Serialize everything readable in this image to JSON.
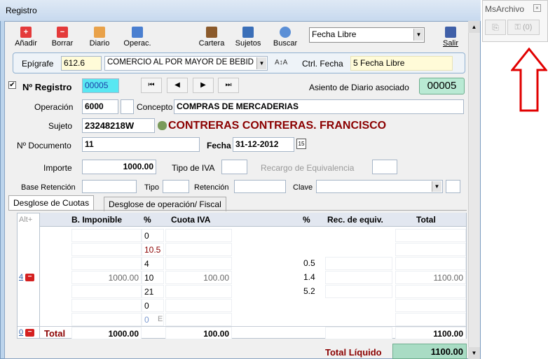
{
  "window": {
    "title": "Registro"
  },
  "toolbar": {
    "add": "Añadir",
    "delete": "Borrar",
    "journal": "Diario",
    "operations": "Operac.",
    "portfolio": "Cartera",
    "subjects": "Sujetos",
    "search": "Buscar",
    "exit": "Salir",
    "date_filter": "Fecha Libre"
  },
  "epigrafe": {
    "label": "Epígrafe",
    "code": "612.6",
    "description": "COMERCIO AL POR MAYOR DE BEBID",
    "ctrl_label": "Ctrl. Fecha",
    "ctrl_value": "5 Fecha Libre"
  },
  "registro": {
    "label": "Nº Registro",
    "value": "00005",
    "asiento_label": "Asiento de Diario asociado",
    "asiento_value": "00005"
  },
  "nav": {
    "first": "⏮",
    "prev": "◀",
    "next": "▶",
    "last": "⏭"
  },
  "form": {
    "operacion_label": "Operación",
    "operacion": "6000",
    "concepto_label": "Concepto",
    "concepto": "COMPRAS DE MERCADERIAS",
    "sujeto_label": "Sujeto",
    "sujeto_id": "23248218W",
    "sujeto_name": "CONTRERAS CONTRERAS. FRANCISCO",
    "documento_label": "Nº Documento",
    "documento": "11",
    "fecha_label": "Fecha",
    "fecha": "31-12-2012",
    "calendar": "15",
    "importe_label": "Importe",
    "importe": "1000.00",
    "tipo_iva_label": "Tipo de IVA",
    "recargo_label": "Recargo de Equivalencia",
    "base_ret_label": "Base Retención",
    "tipo_label": "Tipo",
    "retencion_label": "Retención",
    "clave_label": "Clave"
  },
  "tabs": {
    "cuotas": "Desglose de Cuotas",
    "operacion": "Desglose de operación/ Fiscal"
  },
  "grid": {
    "alt": "Alt+",
    "headers": {
      "base": "B. Imponible",
      "pct": "%",
      "cuota": "Cuota IVA",
      "pct2": "%",
      "rec": "Rec. de equiv.",
      "total": "Total"
    },
    "rows": [
      {
        "base": "",
        "pct": "0",
        "cuota": "",
        "pct2": "",
        "total": ""
      },
      {
        "base": "",
        "pct": "10.5",
        "cuota": "",
        "pct2": "",
        "total": ""
      },
      {
        "base": "",
        "pct": "4",
        "cuota": "",
        "pct2": "0.5",
        "total": ""
      },
      {
        "base": "1000.00",
        "pct": "10",
        "cuota": "100.00",
        "pct2": "1.4",
        "total": "1100.00"
      },
      {
        "base": "",
        "pct": "21",
        "cuota": "",
        "pct2": "5.2",
        "total": ""
      },
      {
        "base": "",
        "pct": "0",
        "cuota": "",
        "pct2": "",
        "total": ""
      },
      {
        "base": "",
        "pct": "0",
        "cuota": "",
        "pct2": "",
        "total": ""
      }
    ],
    "row_marker": "4",
    "extra_marker": "E",
    "total_marker": "0",
    "total_label": "Total",
    "total_base": "1000.00",
    "total_cuota": "100.00",
    "total_total": "1100.00",
    "liquido_label": "Total Líquido",
    "liquido_value": "1100.00"
  },
  "msarchivo": {
    "title": "MsArchivo",
    "count": "(0)"
  }
}
